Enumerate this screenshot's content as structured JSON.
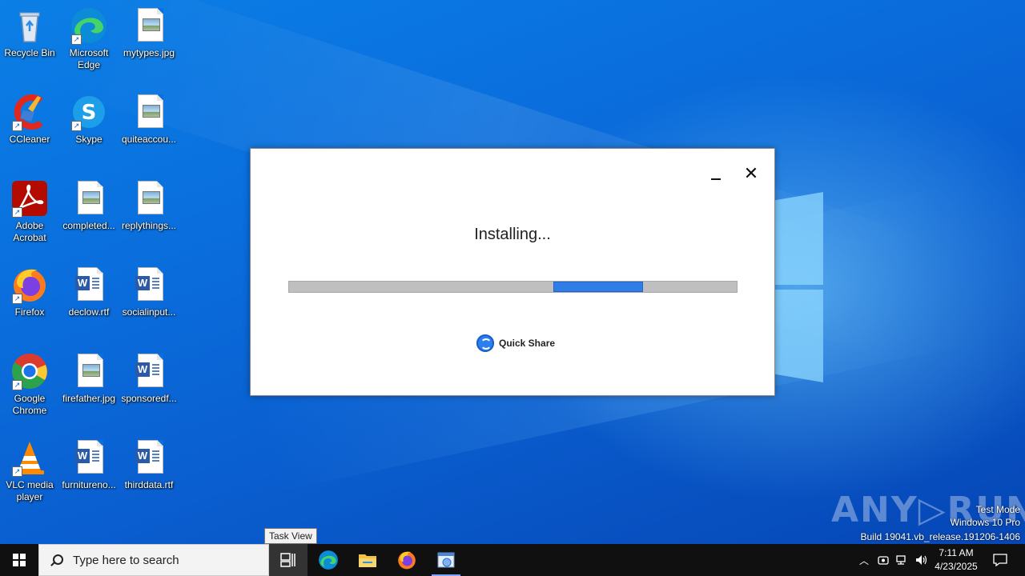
{
  "desktop": {
    "icons": [
      {
        "label": "Recycle Bin",
        "type": "recycle"
      },
      {
        "label": "Microsoft Edge",
        "type": "edge"
      },
      {
        "label": "mytypes.jpg",
        "type": "image"
      },
      {
        "label": "CCleaner",
        "type": "ccleaner"
      },
      {
        "label": "Skype",
        "type": "skype"
      },
      {
        "label": "quiteaccou...",
        "type": "image"
      },
      {
        "label": "Adobe Acrobat",
        "type": "acrobat"
      },
      {
        "label": "completed...",
        "type": "image"
      },
      {
        "label": "replythings...",
        "type": "image"
      },
      {
        "label": "Firefox",
        "type": "firefox"
      },
      {
        "label": "declow.rtf",
        "type": "word"
      },
      {
        "label": "socialinput...",
        "type": "word"
      },
      {
        "label": "Google Chrome",
        "type": "chrome"
      },
      {
        "label": "firefather.jpg",
        "type": "image"
      },
      {
        "label": "sponsoredf...",
        "type": "word"
      },
      {
        "label": "VLC media player",
        "type": "vlc"
      },
      {
        "label": "furnitureno...",
        "type": "word"
      },
      {
        "label": "thirddata.rtf",
        "type": "word"
      }
    ]
  },
  "dialog": {
    "title": "Installing...",
    "progress_fraction": 0.2,
    "progress_offset_fraction": 0.59,
    "brand": "Quick Share"
  },
  "tooltip": "Task View",
  "watermark": {
    "logo": "ANY▷RUN",
    "line1": "Test Mode",
    "line2": "Windows 10 Pro",
    "line3": "Build 19041.vb_release.191206-1406"
  },
  "taskbar": {
    "search_placeholder": "Type here to search",
    "time": "7:11 AM",
    "date": "4/23/2025"
  },
  "colors": {
    "accent": "#2f7de6",
    "taskbar": "#101010"
  }
}
